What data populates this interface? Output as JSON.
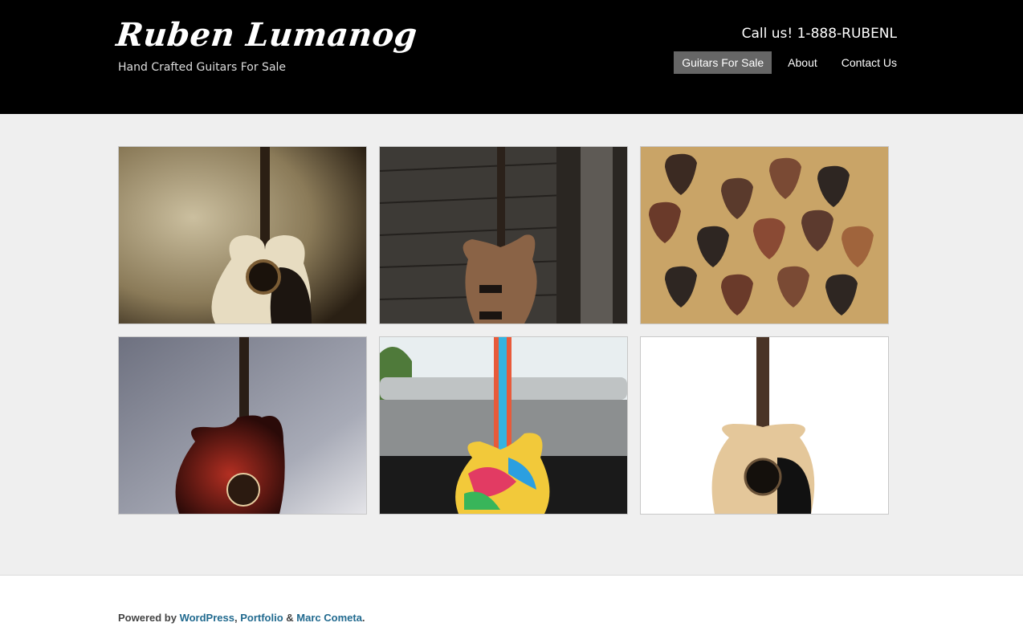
{
  "header": {
    "site_title": "Ruben Lumanog",
    "tagline": "Hand Crafted Guitars For Sale",
    "call_us": "Call us! 1-888-RUBENL",
    "nav": [
      {
        "label": "Guitars For Sale",
        "active": true
      },
      {
        "label": "About",
        "active": false
      },
      {
        "label": "Contact Us",
        "active": false
      }
    ]
  },
  "gallery": {
    "items": [
      {
        "subject": "acoustic guitar against beige wall"
      },
      {
        "subject": "electric guitar against weathered wood"
      },
      {
        "subject": "wooden guitar picks on woven mat"
      },
      {
        "subject": "red sunburst acoustic-electric guitar"
      },
      {
        "subject": "painted multicolor guitar sculpture"
      },
      {
        "subject": "acoustic guitar on white background"
      }
    ]
  },
  "footer": {
    "prefix": "Powered by ",
    "link1": "WordPress",
    "sep1": ", ",
    "link2": "Portfolio",
    "sep2": " & ",
    "link3": "Marc Cometa",
    "suffix": "."
  },
  "colors": {
    "header_bg": "#000000",
    "nav_active_bg": "#666666",
    "page_bg": "#efefef",
    "footer_link": "#216a8f"
  }
}
